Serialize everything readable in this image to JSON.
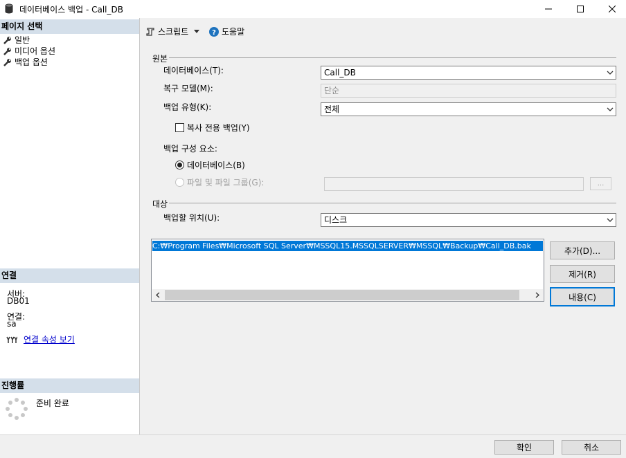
{
  "window": {
    "title": "데이터베이스 백업 - Call_DB"
  },
  "left_panel": {
    "page_select_header": "페이지 선택",
    "pages": [
      "일반",
      "미디어 옵션",
      "백업 옵션"
    ],
    "connection_header": "연결",
    "server_label": "서버:",
    "server_value": "DB01",
    "connection_label": "연결:",
    "connection_value": "sa",
    "view_props_link": "연결 속성 보기",
    "progress_header": "진행률",
    "progress_status": "준비 완료"
  },
  "toolbar": {
    "script_label": "스크립트",
    "help_label": "도움말"
  },
  "source": {
    "group_label": "원본",
    "database_label": "데이터베이스(T):",
    "database_value": "Call_DB",
    "recovery_label": "복구 모델(M):",
    "recovery_value": "단순",
    "backup_type_label": "백업 유형(K):",
    "backup_type_value": "전체",
    "copy_only_label": "복사 전용 백업(Y)",
    "copy_only_checked": false,
    "component_label": "백업 구성 요소:",
    "radio_database_label": "데이터베이스(B)",
    "radio_files_label": "파일 및 파일 그룹(G):",
    "files_browse_label": "..."
  },
  "destination": {
    "group_label": "대상",
    "backup_to_label": "백업할 위치(U):",
    "backup_to_value": "디스크",
    "paths": [
      "C:₩Program Files₩Microsoft SQL Server₩MSSQL15.MSSQLSERVER₩MSSQL₩Backup₩Call_DB.bak"
    ],
    "add_button": "추가(D)...",
    "remove_button": "제거(R)",
    "contents_button": "내용(C)"
  },
  "footer": {
    "ok_button": "확인",
    "cancel_button": "취소"
  }
}
